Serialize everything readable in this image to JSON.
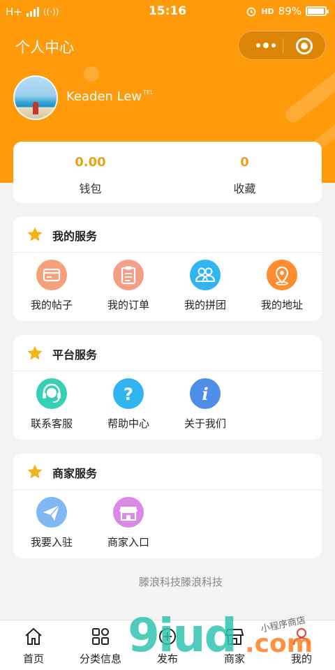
{
  "status_bar": {
    "network": "H+",
    "time": "15:16",
    "battery_percent": "89%",
    "battery_level": 0.89,
    "icons": [
      "signal-icon",
      "wifi-calling-icon",
      "alarm-icon",
      "hd-icon",
      "battery-icon"
    ]
  },
  "header": {
    "title": "个人中心",
    "capsule_icons": [
      "more-dots-icon",
      "target-close-icon"
    ],
    "username": "Keaden Lew",
    "username_sup": "TEL"
  },
  "stats": [
    {
      "value": "0.00",
      "label": "钱包"
    },
    {
      "value": "0",
      "label": "收藏"
    }
  ],
  "sections": [
    {
      "title": "我的服务",
      "items": [
        {
          "label": "我的帖子",
          "icon": "card-icon",
          "color": "#f5a07a"
        },
        {
          "label": "我的订单",
          "icon": "clipboard-icon",
          "color": "#f59e86"
        },
        {
          "label": "我的拼团",
          "icon": "group-icon",
          "color": "#2fb6f0"
        },
        {
          "label": "我的地址",
          "icon": "location-icon",
          "color": "#ff8c2e"
        }
      ]
    },
    {
      "title": "平台服务",
      "items": [
        {
          "label": "联系客服",
          "icon": "headset-icon",
          "color": "#35d0b6"
        },
        {
          "label": "帮助中心",
          "icon": "question-icon",
          "color": "#2fb6f0"
        },
        {
          "label": "关于我们",
          "icon": "info-icon",
          "color": "#4f8ee8"
        }
      ]
    },
    {
      "title": "商家服务",
      "items": [
        {
          "label": "我要入驻",
          "icon": "paper-plane-icon",
          "color": "#7fb8f2"
        },
        {
          "label": "商家入口",
          "icon": "shop-icon",
          "color": "#d78be3"
        }
      ]
    }
  ],
  "footer": "滕浪科技滕浪科技",
  "tabbar": [
    {
      "label": "首页",
      "icon": "home-icon"
    },
    {
      "label": "分类信息",
      "icon": "category-grid-icon"
    },
    {
      "label": "发布",
      "icon": "publish-plus-icon"
    },
    {
      "label": "商家",
      "icon": "store-icon"
    },
    {
      "label": "我的",
      "icon": "user-icon"
    }
  ],
  "watermark": {
    "big": "9iud",
    "com": ".com",
    "small": "小程序商店"
  },
  "colors": {
    "accent": "#ff9a0a",
    "value_gold": "#e8a21a",
    "star": "#f2b31b"
  }
}
